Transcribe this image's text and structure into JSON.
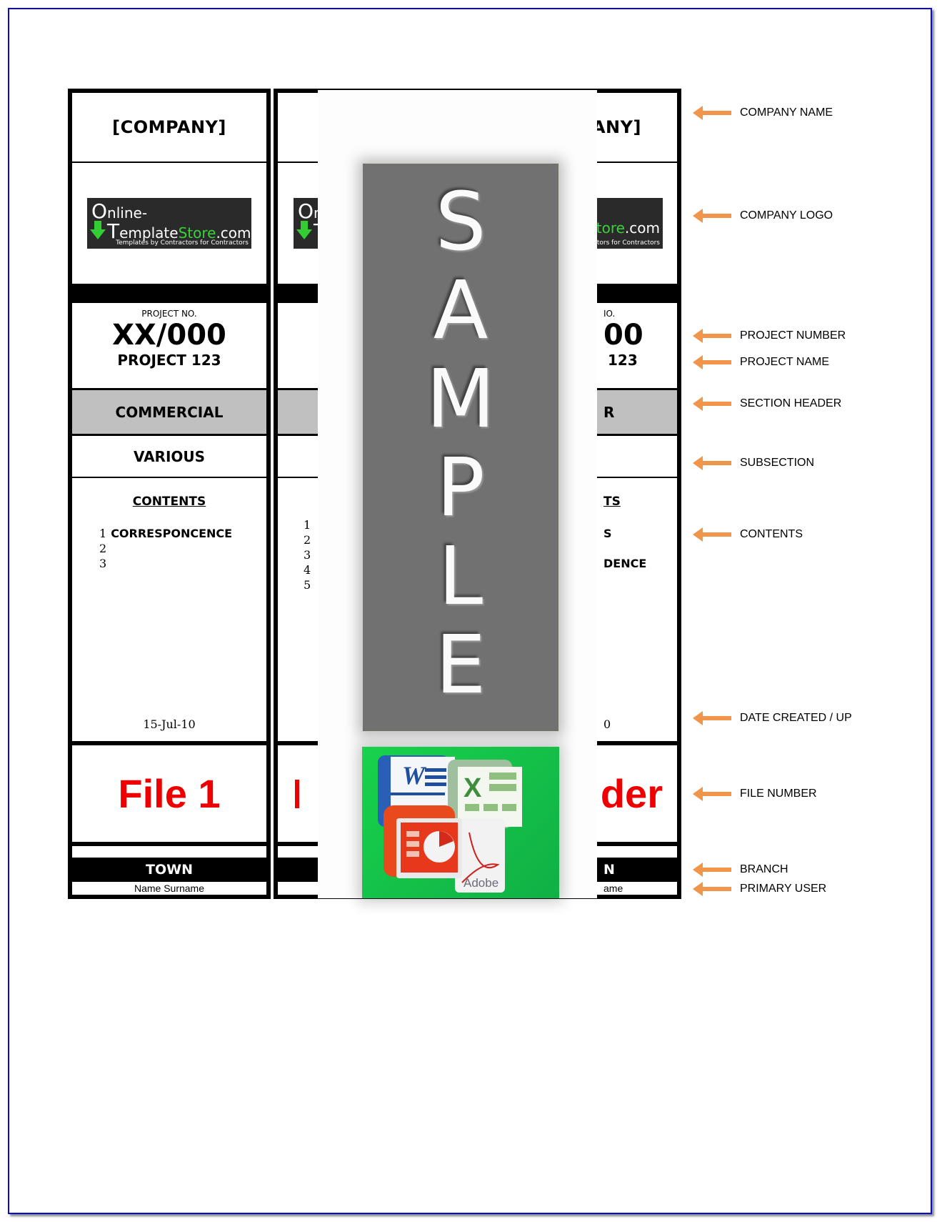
{
  "spines": [
    {
      "company": "[COMPANY]",
      "logo": {
        "line1_initial": "O",
        "line1_rest": "nline-",
        "line2_initial": "T",
        "line2_a": "emplate",
        "line2_b": "Store",
        "line2_c": ".com",
        "tagline": "Templates by Contractors for Contractors"
      },
      "project_label": "PROJECT NO.",
      "project_number": "XX/000",
      "project_name": "PROJECT 123",
      "section": "COMMERCIAL",
      "subsection": "VARIOUS",
      "contents_title": "CONTENTS",
      "contents": [
        {
          "num": "1",
          "text": "CORRESPONCENCE"
        },
        {
          "num": "2",
          "text": ""
        },
        {
          "num": "3",
          "text": ""
        }
      ],
      "date": "15-Jul-10",
      "file": "File 1",
      "branch": "TOWN",
      "user": "Name Surname"
    },
    {
      "contents": [
        {
          "num": "1"
        },
        {
          "num": "2"
        },
        {
          "num": "3"
        },
        {
          "num": "4"
        },
        {
          "num": "5"
        }
      ]
    },
    {
      "company_fragment": "ANY]",
      "logo_fragment_a": "tore",
      "logo_fragment_b": ".com",
      "tagline_fragment": "ctors for Contractors",
      "project_label_fragment": "IO.",
      "project_number_fragment": "00",
      "project_name_fragment": "123",
      "section_fragment": "R",
      "contents_title_fragment": "TS",
      "contents_fragments": [
        "S",
        "",
        "DENCE"
      ],
      "date_fragment": "0",
      "file_fragment": "der",
      "branch_fragment": "N",
      "user_fragment": "ame"
    }
  ],
  "overlay": {
    "watermark_letters": [
      "S",
      "A",
      "M",
      "P",
      "L",
      "E"
    ],
    "office_icons": [
      "word-icon",
      "excel-icon",
      "powerpoint-icon",
      "adobe-icon"
    ],
    "adobe_label": "Adobe",
    "word_letter": "W"
  },
  "annotations": [
    "COMPANY NAME",
    "COMPANY LOGO",
    "PROJECT NUMBER",
    "PROJECT NAME",
    "SECTION HEADER",
    "SUBSECTION",
    "CONTENTS",
    "DATE CREATED / UP",
    "FILE NUMBER",
    "BRANCH",
    "PRIMARY USER"
  ],
  "colors": {
    "frame_border": "#0a0ad0",
    "file_number_red": "#ee0000",
    "section_gray": "#c0c0c0",
    "annotation_arrow": "#f0954a",
    "sample_gray": "#717171",
    "office_green": "#18d24c"
  }
}
